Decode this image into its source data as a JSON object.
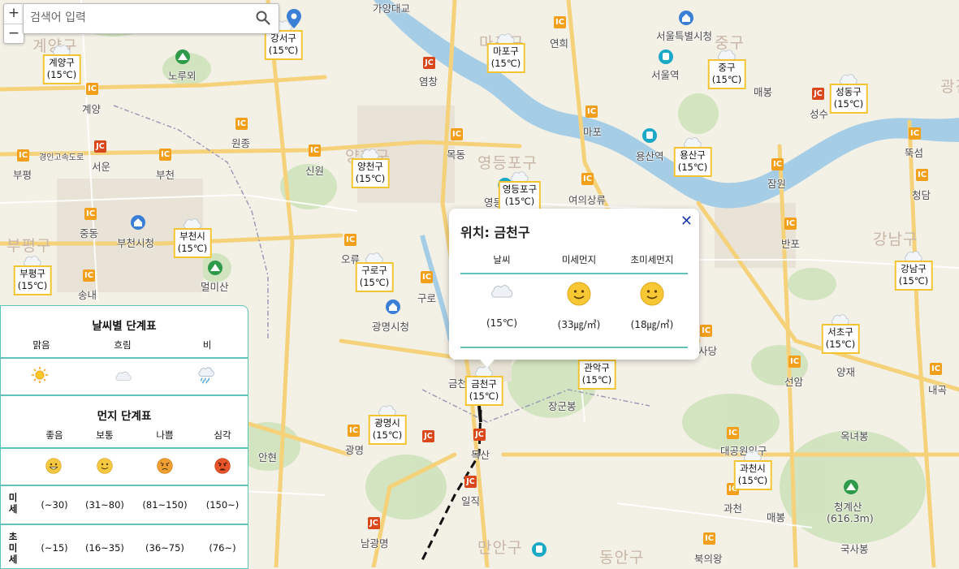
{
  "search": {
    "placeholder": "검색어 입력"
  },
  "zoom": {
    "in": "+",
    "out": "−"
  },
  "districts": [
    {
      "name": "강서구",
      "temp": "(15℃)",
      "weather": "cloudy"
    },
    {
      "name": "계양구",
      "temp": "(15℃)",
      "weather": "cloudy"
    },
    {
      "name": "마포구",
      "temp": "(15℃)",
      "weather": "cloudy"
    },
    {
      "name": "중구",
      "temp": "(15℃)",
      "weather": "cloudy"
    },
    {
      "name": "성동구",
      "temp": "(15℃)",
      "weather": "cloudy"
    },
    {
      "name": "양천구",
      "temp": "(15℃)",
      "weather": "cloudy"
    },
    {
      "name": "용산구",
      "temp": "(15℃)",
      "weather": "cloudy"
    },
    {
      "name": "영등포구",
      "temp": "(15℃)",
      "weather": "cloudy"
    },
    {
      "name": "부천시",
      "temp": "(15℃)",
      "weather": "cloudy"
    },
    {
      "name": "부평구",
      "temp": "(15℃)",
      "weather": "cloudy"
    },
    {
      "name": "구로구",
      "temp": "(15℃)",
      "weather": "cloudy"
    },
    {
      "name": "강남구",
      "temp": "(15℃)",
      "weather": "cloudy"
    },
    {
      "name": "서초구",
      "temp": "(15℃)",
      "weather": "cloudy"
    },
    {
      "name": "관악구",
      "temp": "(15℃)",
      "weather": "cloudy"
    },
    {
      "name": "금천구",
      "temp": "(15℃)",
      "weather": "cloudy"
    },
    {
      "name": "광명시",
      "temp": "(15℃)",
      "weather": "cloudy"
    },
    {
      "name": "과천시",
      "temp": "(15℃)",
      "weather": "cloudy"
    }
  ],
  "places": [
    "가양대교",
    "서울특별시청",
    "노루뫼",
    "염창",
    "연희",
    "서울역",
    "계양",
    "원종",
    "경인고속도로",
    "서운",
    "부천",
    "신원",
    "목동",
    "마포",
    "용산역",
    "성수",
    "부평",
    "영등",
    "여의상류",
    "잠원",
    "뚝섬",
    "청담",
    "중동",
    "부천시청",
    "오류",
    "반포",
    "멀미산",
    "송내",
    "구로",
    "광명시청",
    "사당",
    "금천",
    "선암",
    "양재",
    "내곡",
    "장군봉",
    "안현",
    "광명",
    "독산",
    "대공원입구",
    "옥녀봉",
    "일직",
    "과천",
    "매봉",
    "청계산",
    "(616.3m)",
    "국사봉",
    "남광명",
    "북의왕",
    "매봉"
  ],
  "regions": [
    "마포구",
    "계양구",
    "중구",
    "양천구",
    "영등포구",
    "부평구",
    "강남구",
    "만안구",
    "동안구",
    "광진"
  ],
  "popup": {
    "title": "위치: 금천구",
    "close": "✕",
    "headers": [
      "날씨",
      "미세먼지",
      "초미세먼지"
    ],
    "values": [
      "(15℃)",
      "(33㎍/㎥)",
      "(18㎍/㎥)"
    ],
    "icons": [
      "cloud-icon",
      "smile-face-icon",
      "smile-face-icon"
    ]
  },
  "weather_legend": {
    "title": "날씨별 단계표",
    "columns": [
      "맑음",
      "흐림",
      "비"
    ],
    "icons": [
      "sun-icon",
      "cloud-icon",
      "rain-icon"
    ]
  },
  "dust_legend": {
    "title": "먼지 단계표",
    "columns": [
      "좋음",
      "보통",
      "나쁨",
      "심각"
    ],
    "colors": [
      "#f5c842",
      "#f5c842",
      "#f0a032",
      "#e8552a"
    ],
    "rows": [
      {
        "label": "미세",
        "values": [
          "(~30)",
          "(31~80)",
          "(81~150)",
          "(150~)"
        ]
      },
      {
        "label": "초미세",
        "values": [
          "(~15)",
          "(16~35)",
          "(36~75)",
          "(76~)"
        ]
      }
    ]
  },
  "road_labels": {
    "ic": "IC",
    "jc": "JC"
  }
}
